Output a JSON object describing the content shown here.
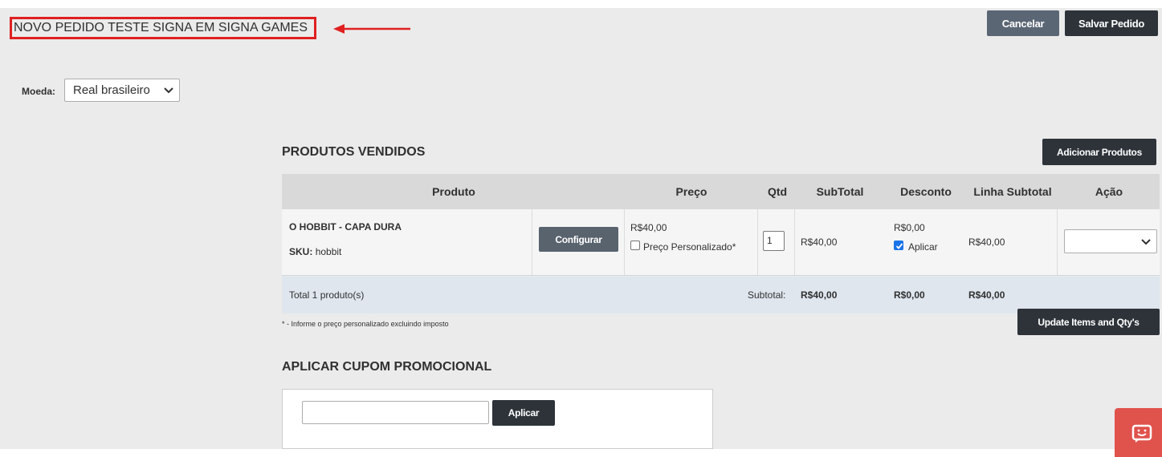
{
  "header": {
    "title": "NOVO PEDIDO TESTE SIGNA EM SIGNA GAMES",
    "cancel_label": "Cancelar",
    "save_label": "Salvar Pedido"
  },
  "currency": {
    "label": "Moeda:",
    "selected": "Real brasileiro"
  },
  "products": {
    "section_title": "PRODUTOS VENDIDOS",
    "add_label": "Adicionar Produtos",
    "columns": [
      "Produto",
      "Preço",
      "Qtd",
      "SubTotal",
      "Desconto",
      "Linha Subtotal",
      "Ação"
    ],
    "rows": [
      {
        "name": "O HOBBIT - CAPA DURA",
        "sku_label": "SKU:",
        "sku": "hobbit",
        "configure_label": "Configurar",
        "price": "R$40,00",
        "custom_price_label": "Preço Personalizado*",
        "custom_price_checked": false,
        "qty": "1",
        "subtotal": "R$40,00",
        "discount": "R$0,00",
        "apply_label": "Aplicar",
        "apply_checked": true,
        "line_subtotal": "R$40,00",
        "action": ""
      }
    ],
    "footer": {
      "total_label": "Total 1 produto(s)",
      "subtotal_label": "Subtotal:",
      "subtotal": "R$40,00",
      "discount": "R$0,00",
      "line_subtotal": "R$40,00"
    },
    "note": "* - Informe o preço personalizado excluindo imposto",
    "update_label": "Update Items and Qty's"
  },
  "coupon": {
    "section_title": "APLICAR CUPOM PROMOCIONAL",
    "input_value": "",
    "apply_label": "Aplicar"
  },
  "colors": {
    "highlight_border": "#e02020",
    "dark_button": "#2d3339",
    "chat_button": "#e0524c"
  }
}
